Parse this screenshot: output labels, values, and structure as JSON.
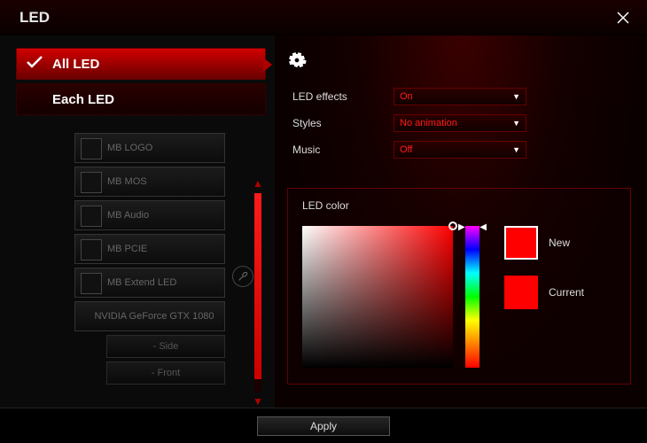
{
  "title": "LED",
  "tabs": {
    "all": "All LED",
    "each": "Each LED"
  },
  "devices": [
    "MB LOGO",
    "MB MOS",
    "MB Audio",
    "MB PCIE",
    "MB Extend LED",
    "NVIDIA GeForce GTX 1080"
  ],
  "sub_devices": [
    "- Side",
    "- Front"
  ],
  "settings": {
    "effects_label": "LED effects",
    "effects_value": "On",
    "styles_label": "Styles",
    "styles_value": "No animation",
    "music_label": "Music",
    "music_value": "Off"
  },
  "color_panel": {
    "title": "LED color",
    "new_label": "New",
    "current_label": "Current",
    "new_color": "#ff0000",
    "current_color": "#ff0000"
  },
  "apply_label": "Apply"
}
